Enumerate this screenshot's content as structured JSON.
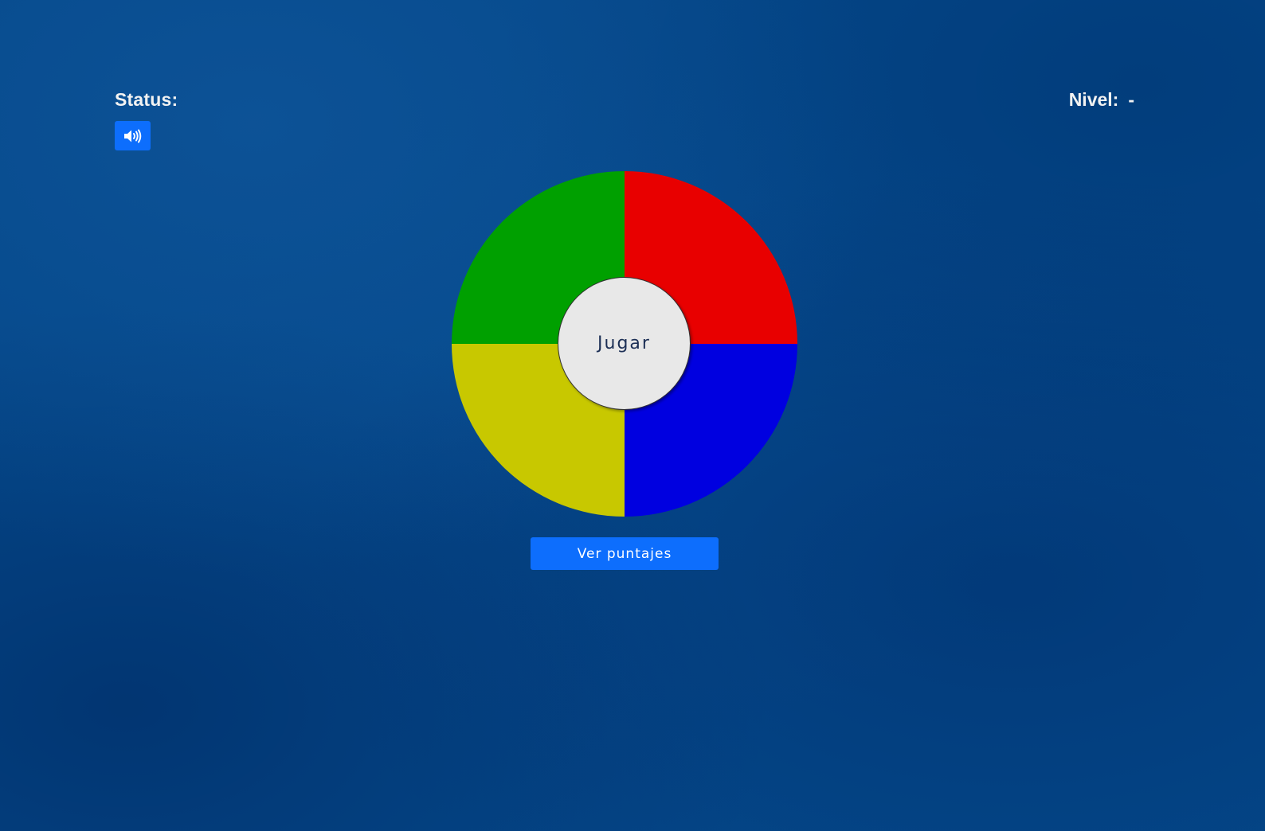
{
  "header": {
    "status_label": "Status:",
    "status_value": "",
    "level_label": "Nivel:",
    "level_value": "-"
  },
  "sound": {
    "icon": "volume-up-icon"
  },
  "board": {
    "quadrants": [
      {
        "name": "green",
        "color": "#00a000"
      },
      {
        "name": "red",
        "color": "#e80000"
      },
      {
        "name": "yellow",
        "color": "#c8c800"
      },
      {
        "name": "blue",
        "color": "#0000e0"
      }
    ],
    "center_label": "Jugar"
  },
  "actions": {
    "scores_label": "Ver puntajes"
  },
  "colors": {
    "background": "#04488a",
    "accent": "#0d6efd",
    "center": "#e8e8e8"
  }
}
